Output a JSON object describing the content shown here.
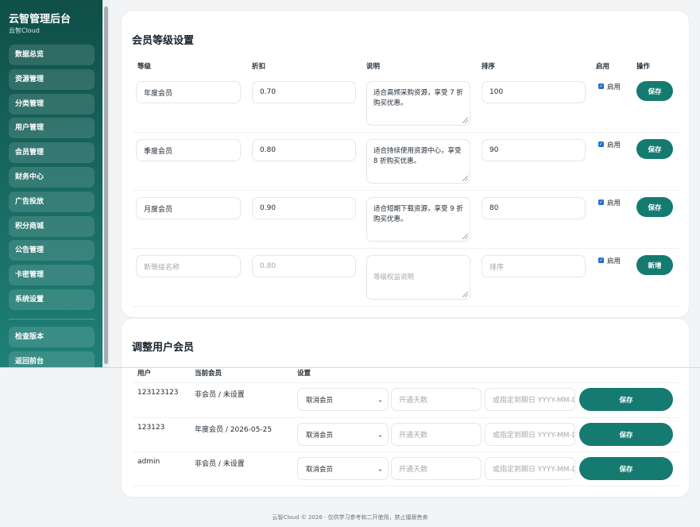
{
  "sidebar": {
    "brand": "云智管理后台",
    "brand_sub": "云智Cloud",
    "items": [
      {
        "label": "数据总览"
      },
      {
        "label": "资源管理"
      },
      {
        "label": "分类管理"
      },
      {
        "label": "用户管理"
      },
      {
        "label": "会员管理"
      },
      {
        "label": "财务中心"
      },
      {
        "label": "广告投放"
      },
      {
        "label": "积分商城"
      },
      {
        "label": "公告管理"
      },
      {
        "label": "卡密管理"
      },
      {
        "label": "系统设置"
      }
    ],
    "bottom_items": [
      {
        "label": "检查版本"
      },
      {
        "label": "返回前台"
      }
    ]
  },
  "levels": {
    "title": "会员等级设置",
    "headers": {
      "level": "等级",
      "discount": "折扣",
      "desc": "说明",
      "sort": "排序",
      "enabled": "启用",
      "action": "操作"
    },
    "rows": [
      {
        "name": "年度会员",
        "discount": "0.70",
        "desc": "适合高频采购资源，享受 7 折购买优惠。",
        "sort": "100",
        "enabled_label": "启用",
        "button": "保存"
      },
      {
        "name": "季度会员",
        "discount": "0.80",
        "desc": "适合持续使用资源中心，享受 8 折购买优惠。",
        "sort": "90",
        "enabled_label": "启用",
        "button": "保存"
      },
      {
        "name": "月度会员",
        "discount": "0.90",
        "desc": "适合短期下载资源，享受 9 折购买优惠。",
        "sort": "80",
        "enabled_label": "启用",
        "button": "保存"
      }
    ],
    "new_row": {
      "name_placeholder": "新等级名称",
      "discount_placeholder": "0.80",
      "desc_placeholder": "等级权益说明",
      "sort_placeholder": "排序",
      "enabled_label": "启用",
      "button": "新增"
    }
  },
  "adjust": {
    "title": "调整用户会员",
    "headers": {
      "user": "用户",
      "current": "当前会员",
      "settings": "设置"
    },
    "rows": [
      {
        "user": "123123123",
        "current": "非会员 / 未设置",
        "select": "取消会员",
        "days_placeholder": "开通天数",
        "date_placeholder": "或指定到期日 YYYY-MM-DD",
        "button": "保存"
      },
      {
        "user": "123123",
        "current": "年度会员 / 2026-05-25",
        "select": "取消会员",
        "days_placeholder": "开通天数",
        "date_placeholder": "或指定到期日 YYYY-MM-DD",
        "button": "保存"
      },
      {
        "user": "admin",
        "current": "非会员 / 未设置",
        "select": "取消会员",
        "days_placeholder": "开通天数",
        "date_placeholder": "或指定到期日 YYYY-MM-DD",
        "button": "保存"
      }
    ]
  },
  "footer": {
    "text": "云智Cloud © 2026 · 仅供学习参考和二开使用，禁止擅贩售卖"
  },
  "colors": {
    "primary": "#157a70",
    "sidebar_top": "#0f4f48",
    "checkbox": "#1d72c7"
  }
}
